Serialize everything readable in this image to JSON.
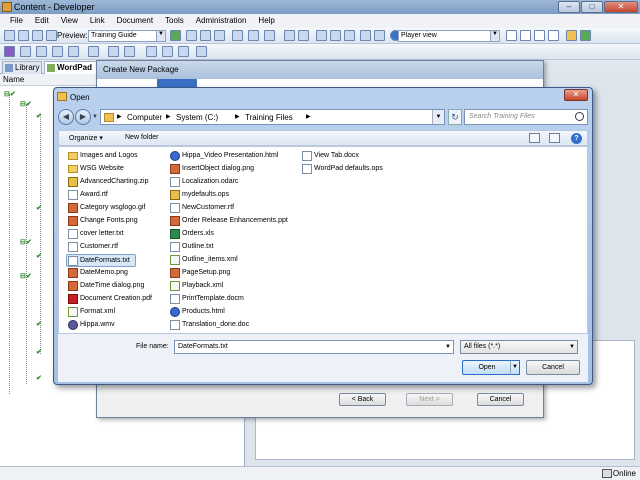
{
  "app": {
    "title": "Content - Developer",
    "menu": [
      "File",
      "Edit",
      "View",
      "Link",
      "Document",
      "Tools",
      "Administration",
      "Help"
    ],
    "toolbar": {
      "preview_label": "Preview:",
      "preview_value": "Training Guide",
      "player_value": "Player view"
    },
    "tabs": [
      {
        "label": "Library",
        "active": false
      },
      {
        "label": "WordPad",
        "active": true
      }
    ],
    "tree_header": "Name",
    "status": "Online"
  },
  "wizard": {
    "title": "Create New Package",
    "back_label": "< Back",
    "next_label": "Next >",
    "cancel_label": "Cancel"
  },
  "open_dialog": {
    "title": "Open",
    "close_label": "✕",
    "breadcrumb": [
      "Computer",
      "System (C:)",
      "Training Files"
    ],
    "search_placeholder": "Search Training Files",
    "organize_label": "Organize ▾",
    "new_folder_label": "New folder",
    "files_col1": [
      {
        "name": "Images and Logos",
        "type": "folder"
      },
      {
        "name": "WSG Website",
        "type": "folder"
      },
      {
        "name": "AdvancedCharting.zip",
        "type": "zip"
      },
      {
        "name": "Award.rtf",
        "type": "doc"
      },
      {
        "name": "Category wsglogo.gif",
        "type": "img"
      },
      {
        "name": "Change Fonts.png",
        "type": "img"
      },
      {
        "name": "cover letter.txt",
        "type": "doc"
      },
      {
        "name": "Customer.rtf",
        "type": "doc"
      },
      {
        "name": "DateFormats.txt",
        "type": "doc",
        "selected": true
      },
      {
        "name": "DateMemo.png",
        "type": "img"
      },
      {
        "name": "DateTime dialog.png",
        "type": "img"
      },
      {
        "name": "Document Creation.pdf",
        "type": "pdf"
      },
      {
        "name": "Format.xml",
        "type": "xml"
      },
      {
        "name": "Hippa.wmv",
        "type": "wmv"
      }
    ],
    "files_col2": [
      {
        "name": "Hippa_Video Presentation.html",
        "type": "web"
      },
      {
        "name": "InsertObject dialog.png",
        "type": "img"
      },
      {
        "name": "Localization.odarc",
        "type": "doc"
      },
      {
        "name": "mydefaults.ops",
        "type": "zip"
      },
      {
        "name": "NewCustomer.rtf",
        "type": "doc"
      },
      {
        "name": "Order Release Enhancements.ppt",
        "type": "img"
      },
      {
        "name": "Orders.xls",
        "type": "xls"
      },
      {
        "name": "Outline.txt",
        "type": "doc"
      },
      {
        "name": "Outline_items.xml",
        "type": "xml"
      },
      {
        "name": "PageSetup.png",
        "type": "img"
      },
      {
        "name": "Playback.xml",
        "type": "xml"
      },
      {
        "name": "PrintTemplate.docm",
        "type": "doc"
      },
      {
        "name": "Products.html",
        "type": "web"
      },
      {
        "name": "Translation_done.doc",
        "type": "doc"
      }
    ],
    "files_col3": [
      {
        "name": "View Tab.docx",
        "type": "doc"
      },
      {
        "name": "WordPad defaults.ops",
        "type": "doc"
      }
    ],
    "file_name_label": "File name:",
    "file_name_value": "DateFormats.txt",
    "filter_value": "All files (*.*)",
    "open_label": "Open",
    "cancel_label": "Cancel"
  }
}
